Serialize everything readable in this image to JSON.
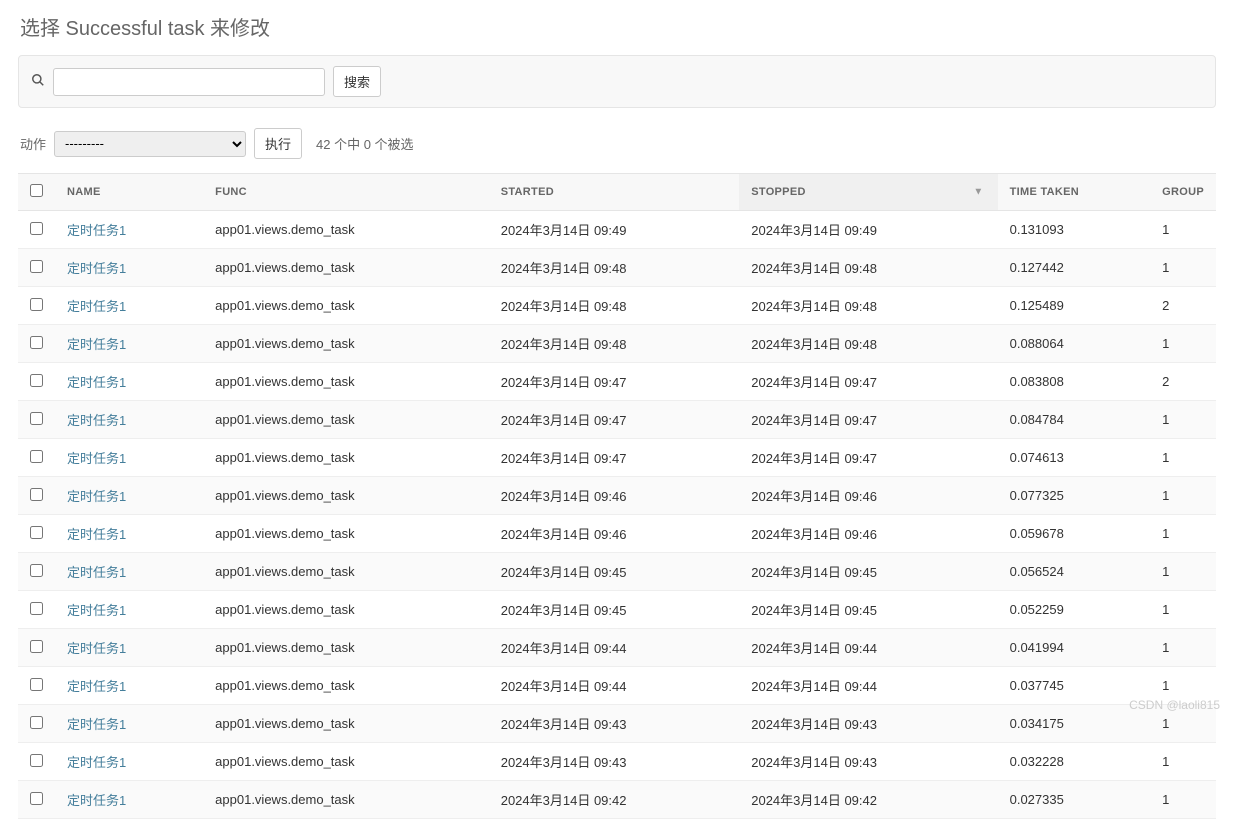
{
  "page_title": "选择 Successful task 来修改",
  "search": {
    "button": "搜索",
    "placeholder": ""
  },
  "actions": {
    "label": "动作",
    "select_placeholder": "---------",
    "go_button": "执行",
    "counter": "42 个中 0 个被选"
  },
  "columns": {
    "name": "NAME",
    "func": "FUNC",
    "started": "STARTED",
    "stopped": "STOPPED",
    "time_taken": "TIME TAKEN",
    "group": "GROUP"
  },
  "sorted_column": "STOPPED",
  "rows": [
    {
      "name": "定时任务1",
      "func": "app01.views.demo_task",
      "started": "2024年3月14日 09:49",
      "stopped": "2024年3月14日 09:49",
      "time_taken": "0.131093",
      "group": "1"
    },
    {
      "name": "定时任务1",
      "func": "app01.views.demo_task",
      "started": "2024年3月14日 09:48",
      "stopped": "2024年3月14日 09:48",
      "time_taken": "0.127442",
      "group": "1"
    },
    {
      "name": "定时任务1",
      "func": "app01.views.demo_task",
      "started": "2024年3月14日 09:48",
      "stopped": "2024年3月14日 09:48",
      "time_taken": "0.125489",
      "group": "2"
    },
    {
      "name": "定时任务1",
      "func": "app01.views.demo_task",
      "started": "2024年3月14日 09:48",
      "stopped": "2024年3月14日 09:48",
      "time_taken": "0.088064",
      "group": "1"
    },
    {
      "name": "定时任务1",
      "func": "app01.views.demo_task",
      "started": "2024年3月14日 09:47",
      "stopped": "2024年3月14日 09:47",
      "time_taken": "0.083808",
      "group": "2"
    },
    {
      "name": "定时任务1",
      "func": "app01.views.demo_task",
      "started": "2024年3月14日 09:47",
      "stopped": "2024年3月14日 09:47",
      "time_taken": "0.084784",
      "group": "1"
    },
    {
      "name": "定时任务1",
      "func": "app01.views.demo_task",
      "started": "2024年3月14日 09:47",
      "stopped": "2024年3月14日 09:47",
      "time_taken": "0.074613",
      "group": "1"
    },
    {
      "name": "定时任务1",
      "func": "app01.views.demo_task",
      "started": "2024年3月14日 09:46",
      "stopped": "2024年3月14日 09:46",
      "time_taken": "0.077325",
      "group": "1"
    },
    {
      "name": "定时任务1",
      "func": "app01.views.demo_task",
      "started": "2024年3月14日 09:46",
      "stopped": "2024年3月14日 09:46",
      "time_taken": "0.059678",
      "group": "1"
    },
    {
      "name": "定时任务1",
      "func": "app01.views.demo_task",
      "started": "2024年3月14日 09:45",
      "stopped": "2024年3月14日 09:45",
      "time_taken": "0.056524",
      "group": "1"
    },
    {
      "name": "定时任务1",
      "func": "app01.views.demo_task",
      "started": "2024年3月14日 09:45",
      "stopped": "2024年3月14日 09:45",
      "time_taken": "0.052259",
      "group": "1"
    },
    {
      "name": "定时任务1",
      "func": "app01.views.demo_task",
      "started": "2024年3月14日 09:44",
      "stopped": "2024年3月14日 09:44",
      "time_taken": "0.041994",
      "group": "1"
    },
    {
      "name": "定时任务1",
      "func": "app01.views.demo_task",
      "started": "2024年3月14日 09:44",
      "stopped": "2024年3月14日 09:44",
      "time_taken": "0.037745",
      "group": "1"
    },
    {
      "name": "定时任务1",
      "func": "app01.views.demo_task",
      "started": "2024年3月14日 09:43",
      "stopped": "2024年3月14日 09:43",
      "time_taken": "0.034175",
      "group": "1"
    },
    {
      "name": "定时任务1",
      "func": "app01.views.demo_task",
      "started": "2024年3月14日 09:43",
      "stopped": "2024年3月14日 09:43",
      "time_taken": "0.032228",
      "group": "1"
    },
    {
      "name": "定时任务1",
      "func": "app01.views.demo_task",
      "started": "2024年3月14日 09:42",
      "stopped": "2024年3月14日 09:42",
      "time_taken": "0.027335",
      "group": "1"
    }
  ],
  "watermark": "CSDN @laoli815"
}
